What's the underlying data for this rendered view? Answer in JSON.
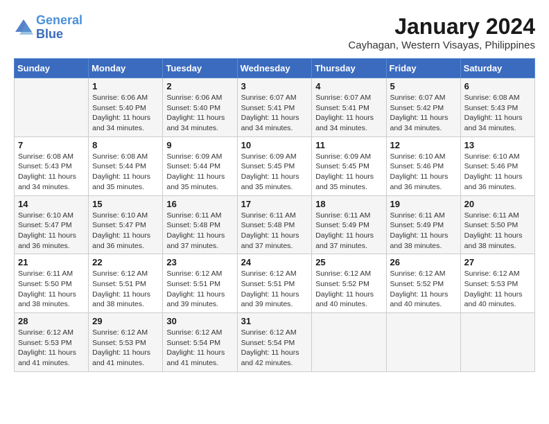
{
  "header": {
    "logo_line1": "General",
    "logo_line2": "Blue",
    "month_title": "January 2024",
    "subtitle": "Cayhagan, Western Visayas, Philippines"
  },
  "columns": [
    "Sunday",
    "Monday",
    "Tuesday",
    "Wednesday",
    "Thursday",
    "Friday",
    "Saturday"
  ],
  "weeks": [
    [
      {
        "day": "",
        "info": ""
      },
      {
        "day": "1",
        "info": "Sunrise: 6:06 AM\nSunset: 5:40 PM\nDaylight: 11 hours\nand 34 minutes."
      },
      {
        "day": "2",
        "info": "Sunrise: 6:06 AM\nSunset: 5:40 PM\nDaylight: 11 hours\nand 34 minutes."
      },
      {
        "day": "3",
        "info": "Sunrise: 6:07 AM\nSunset: 5:41 PM\nDaylight: 11 hours\nand 34 minutes."
      },
      {
        "day": "4",
        "info": "Sunrise: 6:07 AM\nSunset: 5:41 PM\nDaylight: 11 hours\nand 34 minutes."
      },
      {
        "day": "5",
        "info": "Sunrise: 6:07 AM\nSunset: 5:42 PM\nDaylight: 11 hours\nand 34 minutes."
      },
      {
        "day": "6",
        "info": "Sunrise: 6:08 AM\nSunset: 5:43 PM\nDaylight: 11 hours\nand 34 minutes."
      }
    ],
    [
      {
        "day": "7",
        "info": "Sunrise: 6:08 AM\nSunset: 5:43 PM\nDaylight: 11 hours\nand 34 minutes."
      },
      {
        "day": "8",
        "info": "Sunrise: 6:08 AM\nSunset: 5:44 PM\nDaylight: 11 hours\nand 35 minutes."
      },
      {
        "day": "9",
        "info": "Sunrise: 6:09 AM\nSunset: 5:44 PM\nDaylight: 11 hours\nand 35 minutes."
      },
      {
        "day": "10",
        "info": "Sunrise: 6:09 AM\nSunset: 5:45 PM\nDaylight: 11 hours\nand 35 minutes."
      },
      {
        "day": "11",
        "info": "Sunrise: 6:09 AM\nSunset: 5:45 PM\nDaylight: 11 hours\nand 35 minutes."
      },
      {
        "day": "12",
        "info": "Sunrise: 6:10 AM\nSunset: 5:46 PM\nDaylight: 11 hours\nand 36 minutes."
      },
      {
        "day": "13",
        "info": "Sunrise: 6:10 AM\nSunset: 5:46 PM\nDaylight: 11 hours\nand 36 minutes."
      }
    ],
    [
      {
        "day": "14",
        "info": "Sunrise: 6:10 AM\nSunset: 5:47 PM\nDaylight: 11 hours\nand 36 minutes."
      },
      {
        "day": "15",
        "info": "Sunrise: 6:10 AM\nSunset: 5:47 PM\nDaylight: 11 hours\nand 36 minutes."
      },
      {
        "day": "16",
        "info": "Sunrise: 6:11 AM\nSunset: 5:48 PM\nDaylight: 11 hours\nand 37 minutes."
      },
      {
        "day": "17",
        "info": "Sunrise: 6:11 AM\nSunset: 5:48 PM\nDaylight: 11 hours\nand 37 minutes."
      },
      {
        "day": "18",
        "info": "Sunrise: 6:11 AM\nSunset: 5:49 PM\nDaylight: 11 hours\nand 37 minutes."
      },
      {
        "day": "19",
        "info": "Sunrise: 6:11 AM\nSunset: 5:49 PM\nDaylight: 11 hours\nand 38 minutes."
      },
      {
        "day": "20",
        "info": "Sunrise: 6:11 AM\nSunset: 5:50 PM\nDaylight: 11 hours\nand 38 minutes."
      }
    ],
    [
      {
        "day": "21",
        "info": "Sunrise: 6:11 AM\nSunset: 5:50 PM\nDaylight: 11 hours\nand 38 minutes."
      },
      {
        "day": "22",
        "info": "Sunrise: 6:12 AM\nSunset: 5:51 PM\nDaylight: 11 hours\nand 38 minutes."
      },
      {
        "day": "23",
        "info": "Sunrise: 6:12 AM\nSunset: 5:51 PM\nDaylight: 11 hours\nand 39 minutes."
      },
      {
        "day": "24",
        "info": "Sunrise: 6:12 AM\nSunset: 5:51 PM\nDaylight: 11 hours\nand 39 minutes."
      },
      {
        "day": "25",
        "info": "Sunrise: 6:12 AM\nSunset: 5:52 PM\nDaylight: 11 hours\nand 40 minutes."
      },
      {
        "day": "26",
        "info": "Sunrise: 6:12 AM\nSunset: 5:52 PM\nDaylight: 11 hours\nand 40 minutes."
      },
      {
        "day": "27",
        "info": "Sunrise: 6:12 AM\nSunset: 5:53 PM\nDaylight: 11 hours\nand 40 minutes."
      }
    ],
    [
      {
        "day": "28",
        "info": "Sunrise: 6:12 AM\nSunset: 5:53 PM\nDaylight: 11 hours\nand 41 minutes."
      },
      {
        "day": "29",
        "info": "Sunrise: 6:12 AM\nSunset: 5:53 PM\nDaylight: 11 hours\nand 41 minutes."
      },
      {
        "day": "30",
        "info": "Sunrise: 6:12 AM\nSunset: 5:54 PM\nDaylight: 11 hours\nand 41 minutes."
      },
      {
        "day": "31",
        "info": "Sunrise: 6:12 AM\nSunset: 5:54 PM\nDaylight: 11 hours\nand 42 minutes."
      },
      {
        "day": "",
        "info": ""
      },
      {
        "day": "",
        "info": ""
      },
      {
        "day": "",
        "info": ""
      }
    ]
  ]
}
